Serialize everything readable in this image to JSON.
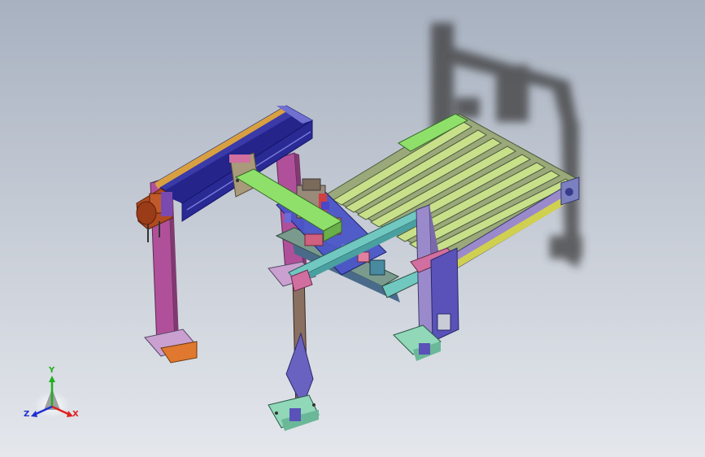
{
  "viewport": {
    "background_top": "#a7b1c0",
    "background_bottom": "#e4e7ec"
  },
  "triad": {
    "x_label": "X",
    "y_label": "Y",
    "z_label": "Z",
    "x_color": "#e02020",
    "y_color": "#20b020",
    "z_color": "#2030d0"
  },
  "model_colors": {
    "gantry_beam": "#3a3aa8",
    "gantry_posts": "#b0509a",
    "servo_motor": "#b04a20",
    "rollers": "#c8e08a",
    "cross_beam": "#8ee06a",
    "conveyor_frame": "#7a9a8e",
    "support_post": "#8a7060",
    "base_plates": "#90d8b8"
  }
}
